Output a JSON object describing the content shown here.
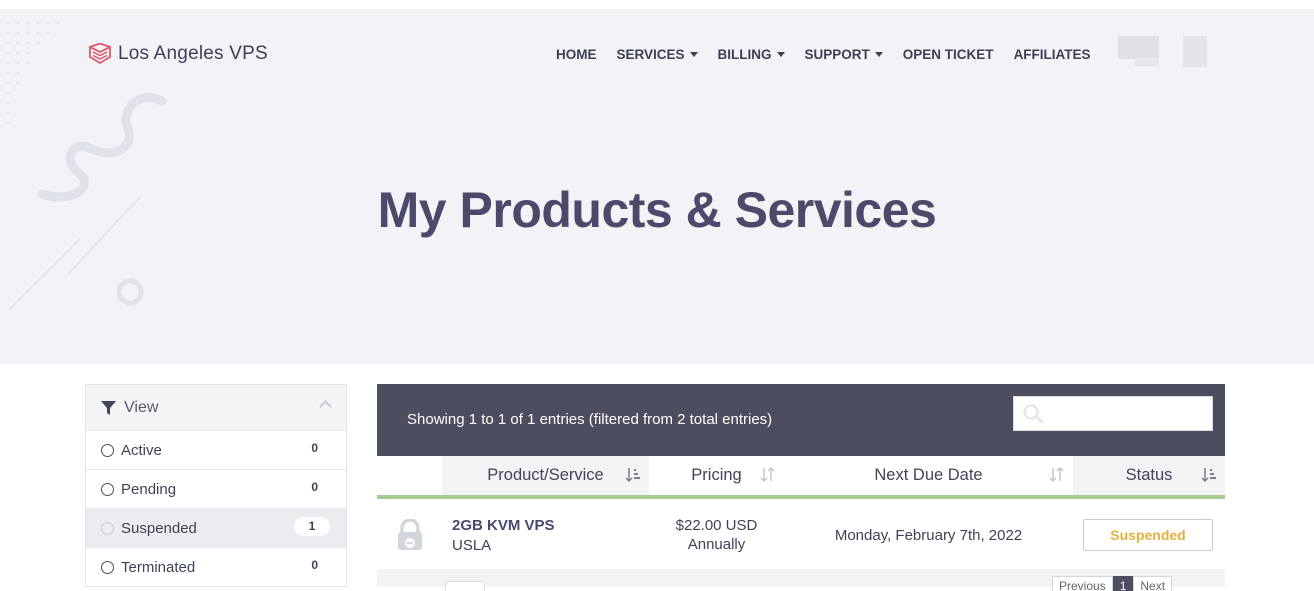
{
  "brand": {
    "name": "Los Angeles VPS",
    "accent": "#e2596c"
  },
  "nav": {
    "home": "HOME",
    "services": "SERVICES",
    "billing": "BILLING",
    "support": "SUPPORT",
    "open_ticket": "OPEN TICKET",
    "affiliates": "AFFILIATES"
  },
  "page": {
    "title": "My Products & Services"
  },
  "sidebar": {
    "header": "View",
    "items": [
      {
        "label": "Active",
        "count": "0"
      },
      {
        "label": "Pending",
        "count": "0"
      },
      {
        "label": "Suspended",
        "count": "1"
      },
      {
        "label": "Terminated",
        "count": "0"
      }
    ]
  },
  "table": {
    "info": "Showing 1 to 1 of 1 entries (filtered from 2 total entries)",
    "search_placeholder": "",
    "columns": [
      "Product/Service",
      "Pricing",
      "Next Due Date",
      "Status"
    ],
    "rows": [
      {
        "product": "2GB KVM VPS",
        "location": "USLA",
        "price": "$22.00 USD",
        "cycle": "Annually",
        "due": "Monday, February 7th, 2022",
        "status": "Suspended",
        "status_color": "#e6b03f"
      }
    ],
    "pager": {
      "prev": "Previous",
      "current": "1",
      "next": "Next"
    }
  },
  "colors": {
    "header_bar": "#4c4e5f",
    "sort_underline": "#a8c98f",
    "hero_bg": "#f1f3f7"
  }
}
